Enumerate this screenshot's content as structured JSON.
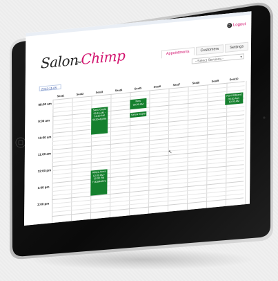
{
  "app": {
    "logo": {
      "part1": "Salon",
      "part2": "Chimp"
    },
    "logout_label": "Logout",
    "tabs": [
      {
        "label": "Appointments",
        "active": true
      },
      {
        "label": "Customers",
        "active": false
      },
      {
        "label": "Settings",
        "active": false
      }
    ],
    "service_select_placeholder": "--Select Services--",
    "date_value": "2013-11-05",
    "seats": [
      "Seat1",
      "Seat2",
      "Seat3",
      "Seat4",
      "Seat5",
      "Seat6",
      "Seat7",
      "Seat8",
      "Seat9",
      "Seat10"
    ],
    "time_slots": [
      "08:00 am",
      "9:00 am",
      "10:00 am",
      "11:00 am",
      "12:00 pm",
      "1:00 pm",
      "2:00 pm"
    ],
    "appointments": [
      {
        "lines": [
          "Sanu Gupta",
          "09:15 AM -",
          "11:30 AM",
          "9620441898"
        ]
      },
      {
        "lines": [
          "Neru",
          "09:00 AM"
        ]
      },
      {
        "lines": [
          "Sanya Gupta"
        ]
      },
      {
        "lines": [
          "Ravi Hillstand",
          "09:30 AM -",
          "10:00 AM"
        ]
      },
      {
        "lines": [
          "Aditya Arora",
          "12:00 AM -",
          "12:30 PM",
          "7743844671"
        ]
      }
    ],
    "accent_color": "#d2136e",
    "appointment_color": "#15802e"
  }
}
